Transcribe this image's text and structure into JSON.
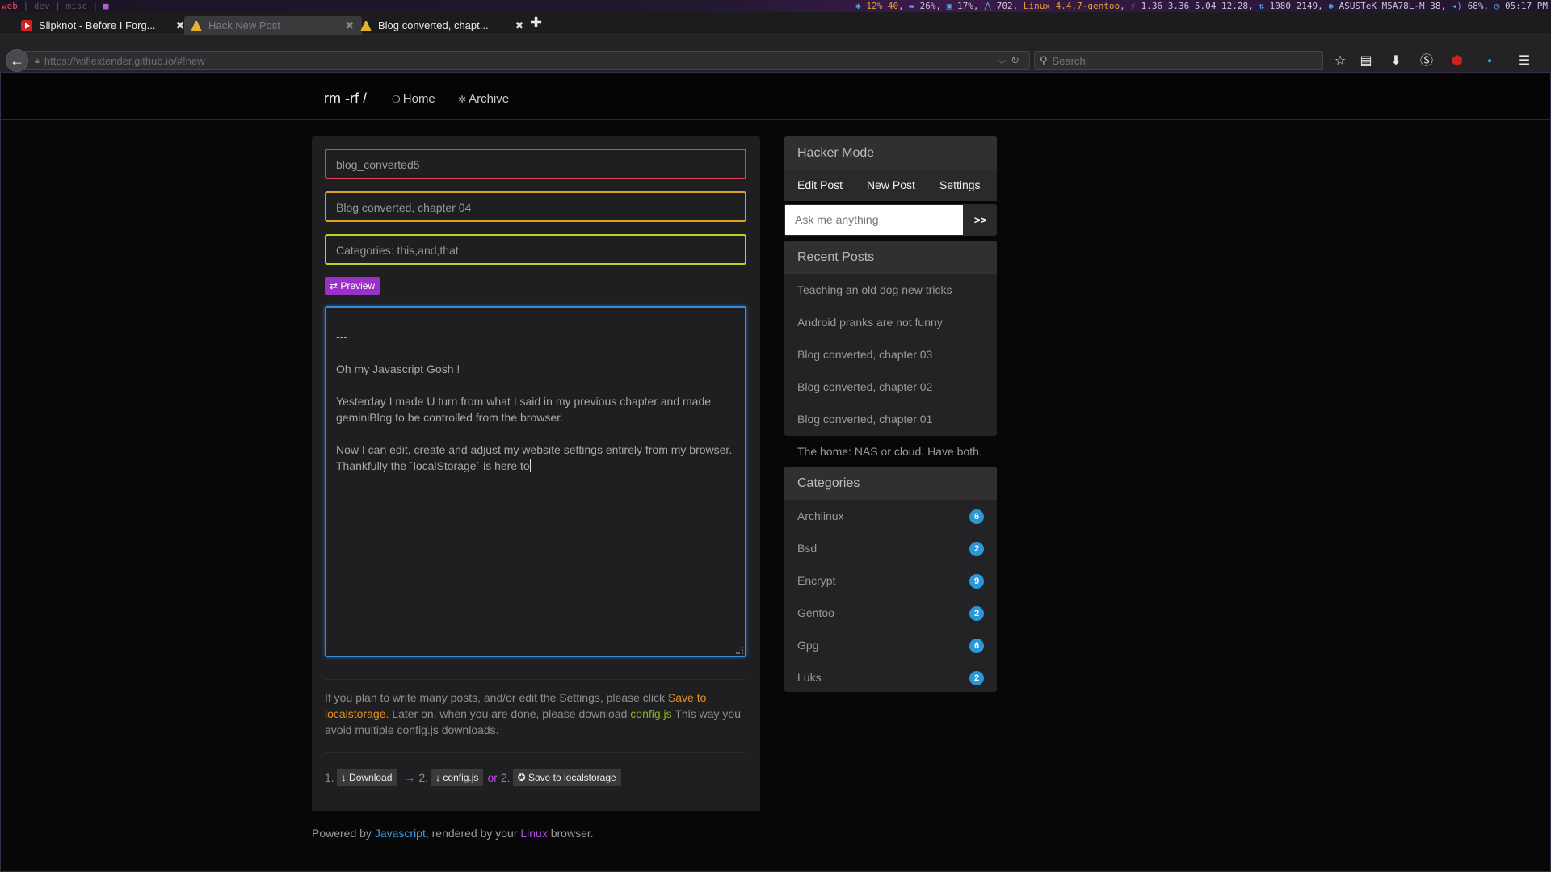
{
  "sysbar": {
    "workspaces": {
      "active": "web",
      "others": "| dev | misc |",
      "mark": "■"
    },
    "status": {
      "cpu": "12% 40",
      "mem": "26%",
      "disk": "17%",
      "procs": "702",
      "kernel": "Linux 4.4.7-gentoo",
      "load": "1.36 3.36 5.04 12.28",
      "net": "1080 2149",
      "board": "ASUSTeK M5A78L-M 38",
      "vol": "68%",
      "time": "05:17 PM"
    }
  },
  "tabs": [
    {
      "label": "Slipknot - Before I Forg...",
      "icon": "youtube-icon"
    },
    {
      "label": "Hack New Post",
      "icon": "tux-icon"
    },
    {
      "label": "Blog converted, chapt...",
      "icon": "tux-icon"
    }
  ],
  "nav": {
    "url": "https://wifiextender.github.io/#!new",
    "search_placeholder": "Search"
  },
  "site": {
    "brand": "rm -rf /",
    "nav_home": "Home",
    "nav_archive": "Archive"
  },
  "editor": {
    "slug": "blog_converted5",
    "title": "Blog converted, chapter 04",
    "categories": "Categories: this,and,that",
    "preview_label": "⇄ Preview",
    "body": "---\n\nOh my Javascript Gosh !\n\nYesterday I made U turn from what I said in my previous chapter and made geminiBlog to be controlled from the browser.\n\nNow I can edit, create and adjust my website settings entirely from my browser. Thankfully the `localStorage` is here to"
  },
  "info": {
    "part1": "If you plan to write many posts, and/or edit the Settings, please click ",
    "link1": "Save to localstorage",
    "part2": ". Later on, when you are done, please download ",
    "link2": "config.js",
    "part3": " This way you avoid multiple config.js downloads."
  },
  "actions": {
    "step1": "1.",
    "download": "↓ Download",
    "arrow": "→",
    "step2": "2.",
    "configjs": "↓ config.js",
    "or": "or",
    "step2b": "2.",
    "save": "✪ Save to localstorage"
  },
  "footer": {
    "p1": "Powered by ",
    "js": "Javascript",
    "p2": ", rendered by your ",
    "linux": "Linux",
    "p3": " browser."
  },
  "sidebar": {
    "hacker_title": "Hacker Mode",
    "hacker_tabs": [
      "Edit Post",
      "New Post",
      "Settings"
    ],
    "ask_placeholder": "Ask me anything",
    "ask_button": ">>",
    "recent_title": "Recent Posts",
    "recent": [
      "Teaching an old dog new tricks",
      "Android pranks are not funny",
      "Blog converted, chapter 03",
      "Blog converted, chapter 02",
      "Blog converted, chapter 01",
      "The home: NAS or cloud. Have both."
    ],
    "categories_title": "Categories",
    "categories": [
      {
        "name": "Archlinux",
        "count": "6"
      },
      {
        "name": "Bsd",
        "count": "2"
      },
      {
        "name": "Encrypt",
        "count": "9"
      },
      {
        "name": "Gentoo",
        "count": "2"
      },
      {
        "name": "Gpg",
        "count": "6"
      },
      {
        "name": "Luks",
        "count": "2"
      }
    ]
  },
  "colors": {
    "slug_border": "#e04455",
    "title_border": "#e0a020",
    "cat_border": "#c0d020",
    "preview_bg": "#9a30c8",
    "editor_border": "#3a8ad8",
    "badge": "#2a98d8"
  }
}
